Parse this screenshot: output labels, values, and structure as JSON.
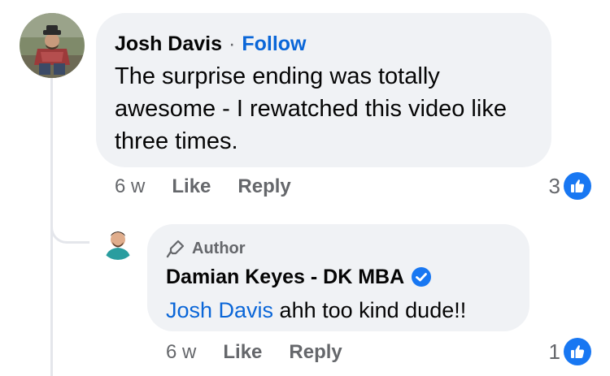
{
  "comment": {
    "author": "Josh Davis",
    "separator": "·",
    "follow_label": "Follow",
    "text": "The surprise ending was totally awesome - I rewatched this video like three times.",
    "time": "6 w",
    "like_label": "Like",
    "reply_label": "Reply",
    "reaction_count": "3",
    "reaction_icon": "like-icon"
  },
  "reply": {
    "badge_label": "Author",
    "badge_icon": "microphone-icon",
    "author": "Damian Keyes - DK MBA",
    "verified_icon": "verified-badge-icon",
    "mention": "Josh Davis",
    "text": " ahh too kind dude!!",
    "time": "6 w",
    "like_label": "Like",
    "reply_label": "Reply",
    "reaction_count": "1",
    "reaction_icon": "like-icon"
  },
  "colors": {
    "bubble": "#f0f2f5",
    "link": "#0a66d8",
    "secondary_text": "#65676b",
    "like_blue": "#1877f2"
  }
}
